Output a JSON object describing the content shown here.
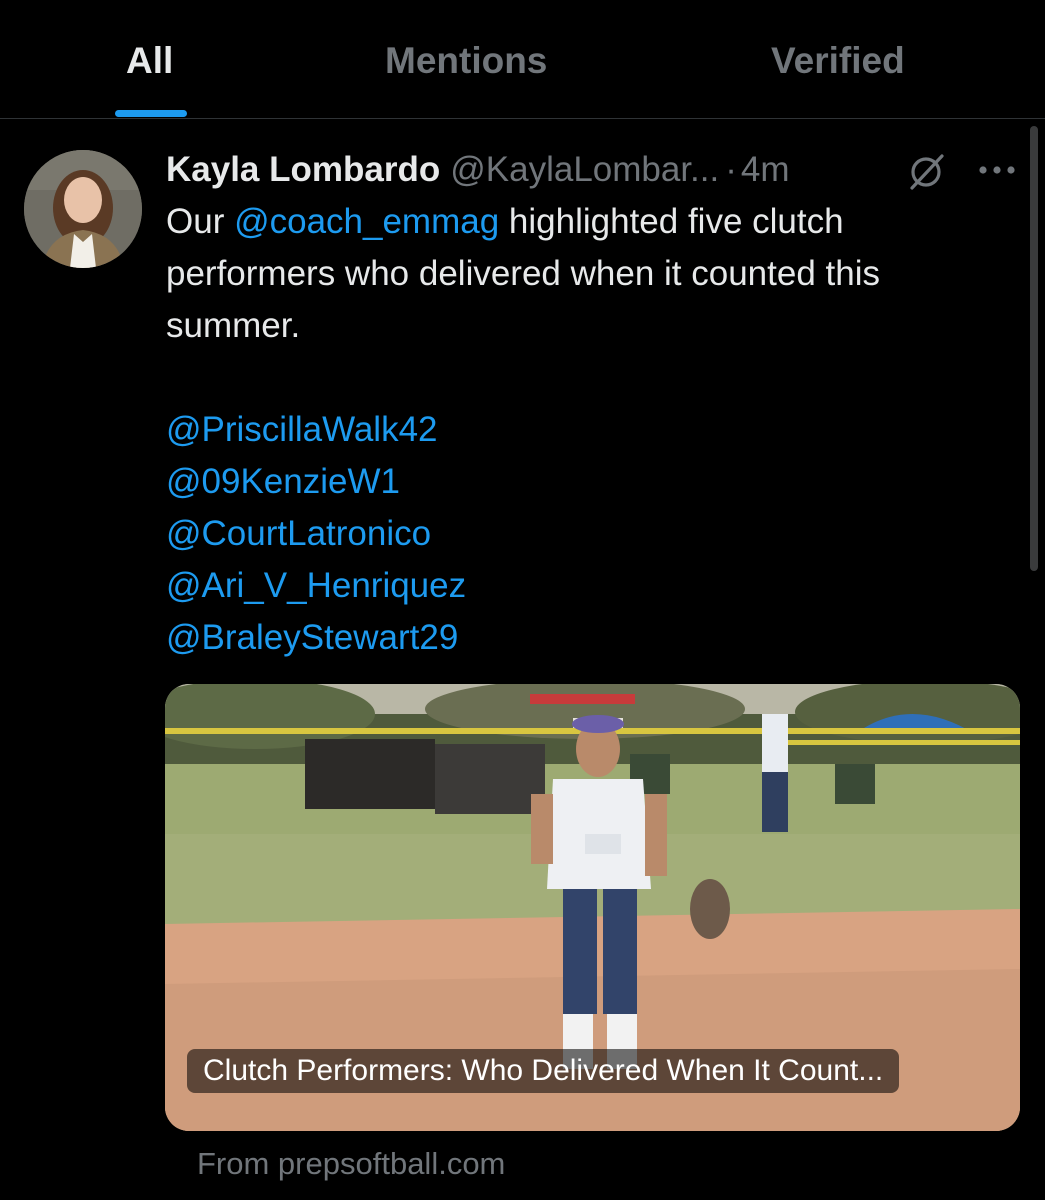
{
  "tabs": [
    {
      "label": "All",
      "active": true
    },
    {
      "label": "Mentions",
      "active": false
    },
    {
      "label": "Verified",
      "active": false
    }
  ],
  "tweet": {
    "author_name": "Kayla Lombardo",
    "author_handle": "@KaylaLombar...",
    "separator": "·",
    "time": "4m",
    "text": {
      "prefix": "Our ",
      "mention": "@coach_emmag",
      "line1_suffix": " highlighted five clutch",
      "line2": "performers who delivered when it counted this",
      "line3": "summer."
    },
    "mentions": [
      "@PriscillaWalk42",
      "@09KenzieW1",
      "@CourtLatronico",
      "@Ari_V_Henriquez",
      "@BraleyStewart29"
    ],
    "card": {
      "caption": "Clutch Performers: Who Delivered When It Count...",
      "source": "From prepsoftball.com"
    }
  },
  "icons": {
    "grok": "grok-slash-icon",
    "more": "more-dots-icon"
  },
  "colors": {
    "background": "#000000",
    "text": "#e7e9ea",
    "muted": "#71767b",
    "accent": "#1d9bf0",
    "divider": "#2f3336"
  }
}
